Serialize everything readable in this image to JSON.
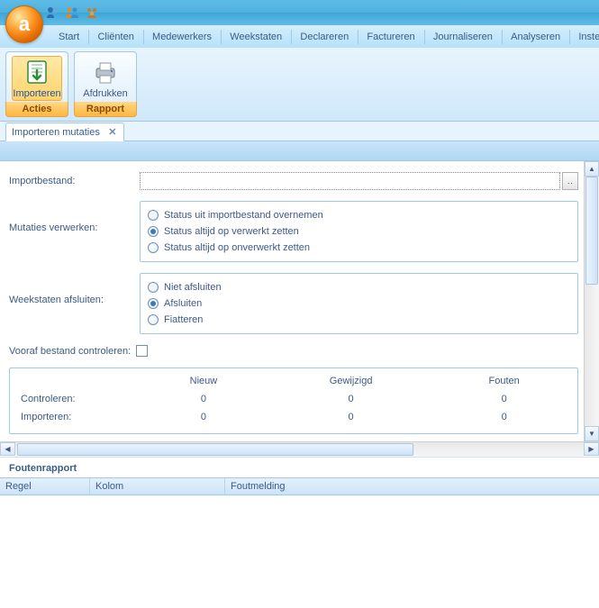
{
  "menu": {
    "items": [
      "Start",
      "Cliënten",
      "Medewerkers",
      "Weekstaten",
      "Declareren",
      "Factureren",
      "Journaliseren",
      "Analyseren",
      "Instellingen"
    ]
  },
  "ribbon": {
    "groups": [
      {
        "title": "Acties",
        "active": true,
        "buttons": [
          {
            "name": "importeren",
            "label": "Importeren",
            "selected": true
          }
        ]
      },
      {
        "title": "Rapport",
        "activeTitle": true,
        "buttons": [
          {
            "name": "afdrukken",
            "label": "Afdrukken"
          }
        ]
      }
    ]
  },
  "doctab": {
    "label": "Importeren mutaties"
  },
  "form": {
    "importbestand_label": "Importbestand:",
    "importbestand_value": "",
    "browse": "‥",
    "mutaties_label": "Mutaties verwerken:",
    "mutaties_options": [
      "Status uit importbestand overnemen",
      "Status altijd op verwerkt zetten",
      "Status altijd op onverwerkt zetten"
    ],
    "mutaties_selected": 1,
    "weekstaten_label": "Weekstaten afsluiten:",
    "weekstaten_options": [
      "Niet afsluiten",
      "Afsluiten",
      "Fiatteren"
    ],
    "weekstaten_selected": 1,
    "vooraf_label": "Vooraf bestand controleren:",
    "stats": {
      "cols": [
        "Nieuw",
        "Gewijzigd",
        "Fouten"
      ],
      "rows": [
        {
          "label": "Controleren:",
          "vals": [
            "0",
            "0",
            "0"
          ]
        },
        {
          "label": "Importeren:",
          "vals": [
            "0",
            "0",
            "0"
          ]
        }
      ]
    }
  },
  "errors": {
    "title": "Foutenrapport",
    "cols": [
      "Regel",
      "Kolom",
      "Foutmelding"
    ]
  }
}
